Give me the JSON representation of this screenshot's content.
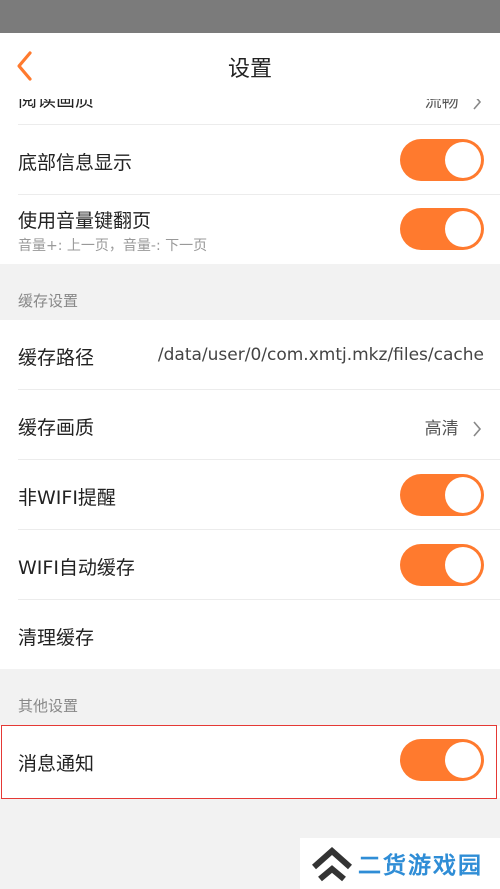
{
  "nav": {
    "title": "设置"
  },
  "reading": {
    "partial_label": "阅读画质",
    "partial_value": "流畅"
  },
  "display": {
    "bottom_info_label": "底部信息显示",
    "bottom_info_on": true,
    "volume_page_label": "使用音量键翻页",
    "volume_page_sub": "音量+: 上一页，音量-: 下一页",
    "volume_page_on": true
  },
  "cache": {
    "section_title": "缓存设置",
    "path_label": "缓存路径",
    "path_value": "/data/user/0/com.xmtj.mkz/files/cache",
    "quality_label": "缓存画质",
    "quality_value": "高清",
    "non_wifi_label": "非WIFI提醒",
    "non_wifi_on": true,
    "wifi_auto_label": "WIFI自动缓存",
    "wifi_auto_on": true,
    "clear_label": "清理缓存"
  },
  "other": {
    "section_title": "其他设置",
    "notify_label": "消息通知",
    "notify_on": true
  },
  "watermark": {
    "text": "二货游戏园"
  },
  "colors": {
    "accent": "#ff7a2e",
    "highlight": "#e53935",
    "watermark": "#2f8dd6"
  }
}
